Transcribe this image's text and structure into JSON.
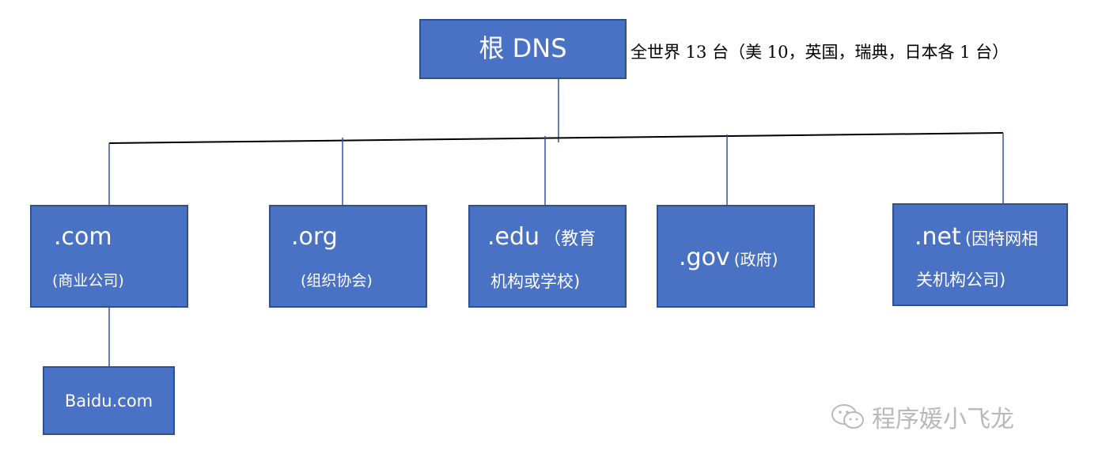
{
  "root": {
    "label": "根 DNS",
    "note": "全世界 13 台（美 10，英国，瑞典，日本各 1 台）"
  },
  "tlds": {
    "com": {
      "name": ".com",
      "desc": "(商业公司)"
    },
    "org": {
      "name": ".org",
      "desc": "(组织协会)"
    },
    "edu": {
      "name": ".edu",
      "desc_inline": "（教育",
      "desc_line2": "机构或学校)"
    },
    "gov": {
      "name": ".gov",
      "desc_inline": "(政府)"
    },
    "net": {
      "name": ".net",
      "desc_inline": "(因特网相",
      "desc_line2": "关机构公司)"
    }
  },
  "leaf": {
    "label": "Baidu.com"
  },
  "watermark": {
    "text": "程序媛小飞龙",
    "icon": "wechat-icon"
  },
  "colors": {
    "node_fill": "#4a72c4",
    "node_border": "#2f528f",
    "line": "#2f5597",
    "bus": "#000000",
    "watermark": "#b9b9b9"
  }
}
